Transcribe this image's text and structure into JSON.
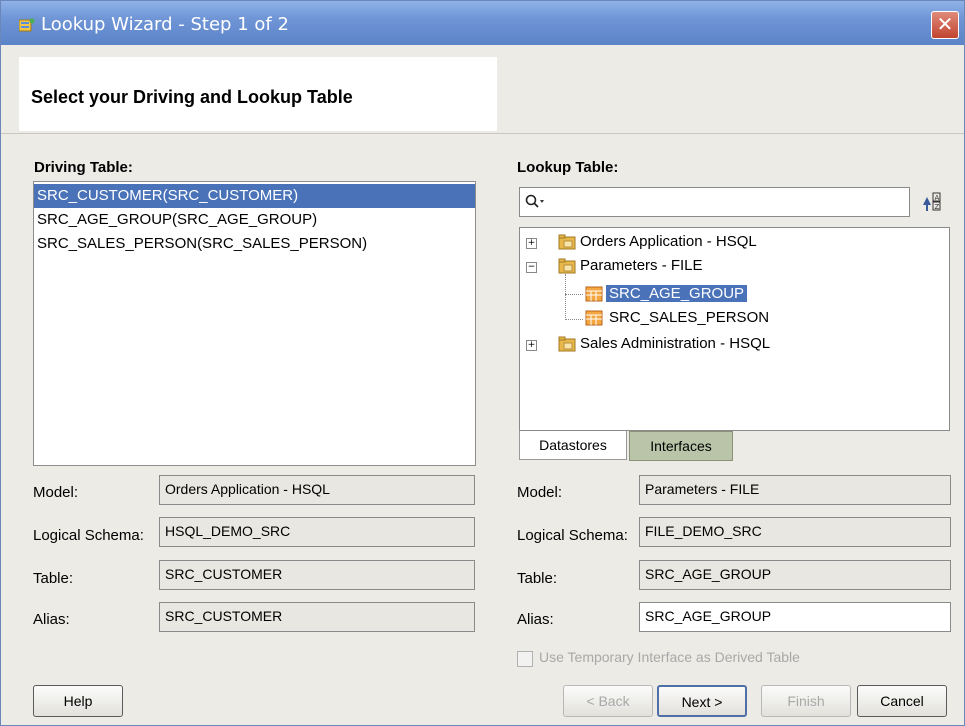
{
  "window": {
    "title": "Lookup Wizard - Step 1 of 2",
    "close_label": "✕"
  },
  "header": {
    "title": "Select your Driving and Lookup Table"
  },
  "driving": {
    "heading": "Driving Table:",
    "items": [
      {
        "label": "SRC_CUSTOMER(SRC_CUSTOMER)",
        "selected": true
      },
      {
        "label": "SRC_AGE_GROUP(SRC_AGE_GROUP)",
        "selected": false
      },
      {
        "label": "SRC_SALES_PERSON(SRC_SALES_PERSON)",
        "selected": false
      }
    ],
    "model_label": "Model:",
    "model_value": "Orders Application - HSQL",
    "schema_label": "Logical Schema:",
    "schema_value": "HSQL_DEMO_SRC",
    "table_label": "Table:",
    "table_value": "SRC_CUSTOMER",
    "alias_label": "Alias:",
    "alias_value": "SRC_CUSTOMER"
  },
  "lookup": {
    "heading": "Lookup Table:",
    "search_placeholder": "",
    "tree": [
      {
        "label": "Orders Application - HSQL",
        "expander": "+"
      },
      {
        "label": "Parameters - FILE",
        "expander": "−"
      },
      {
        "label": "SRC_AGE_GROUP"
      },
      {
        "label": "SRC_SALES_PERSON"
      },
      {
        "label": "Sales Administration - HSQL",
        "expander": "+"
      }
    ],
    "tabs": [
      "Datastores",
      "Interfaces"
    ],
    "model_label": "Model:",
    "model_value": "Parameters - FILE",
    "schema_label": "Logical Schema:",
    "schema_value": "FILE_DEMO_SRC",
    "table_label": "Table:",
    "table_value": "SRC_AGE_GROUP",
    "alias_label": "Alias:",
    "alias_value": "SRC_AGE_GROUP",
    "derived_label": "Use Temporary Interface as Derived Table"
  },
  "buttons": {
    "help": "Help",
    "back": "< Back",
    "next": "Next >",
    "finish": "Finish",
    "cancel": "Cancel"
  },
  "colors": {
    "selection": "#4a72b8",
    "titlebar": "#6f95d6"
  }
}
